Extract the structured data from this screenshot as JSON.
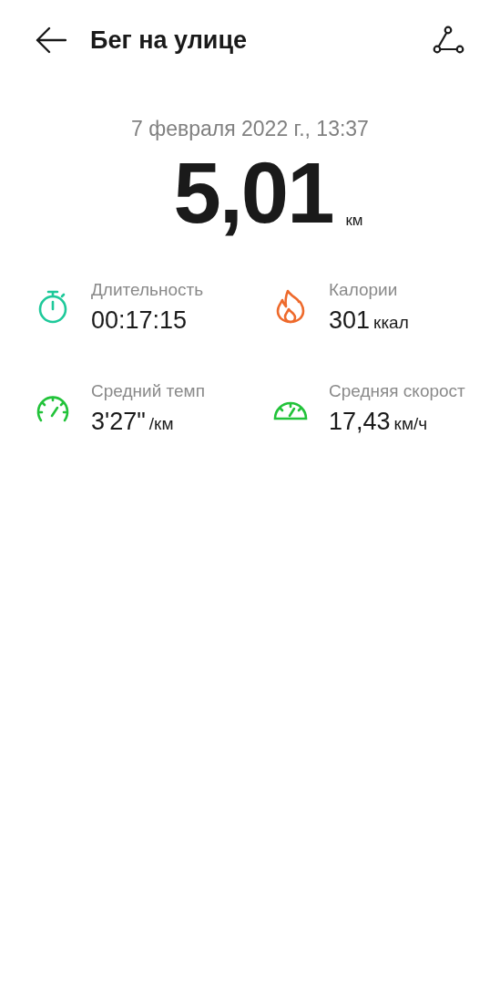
{
  "header": {
    "title": "Бег на улице"
  },
  "date": "7 февраля 2022 г., 13:37",
  "distance": {
    "value": "5,01",
    "unit": "км"
  },
  "stats": [
    {
      "kind": "stopwatch",
      "label": "Длительность",
      "value": "00:17:15"
    },
    {
      "kind": "flame",
      "label": "Калории",
      "value": "301",
      "unit": "ккал"
    },
    {
      "kind": "pace",
      "label": "Средний темп",
      "value": "3'27\"",
      "unit": "/км"
    },
    {
      "kind": "speed",
      "label": "Средняя скорост",
      "value": "17,43",
      "unit": "км/ч"
    }
  ]
}
